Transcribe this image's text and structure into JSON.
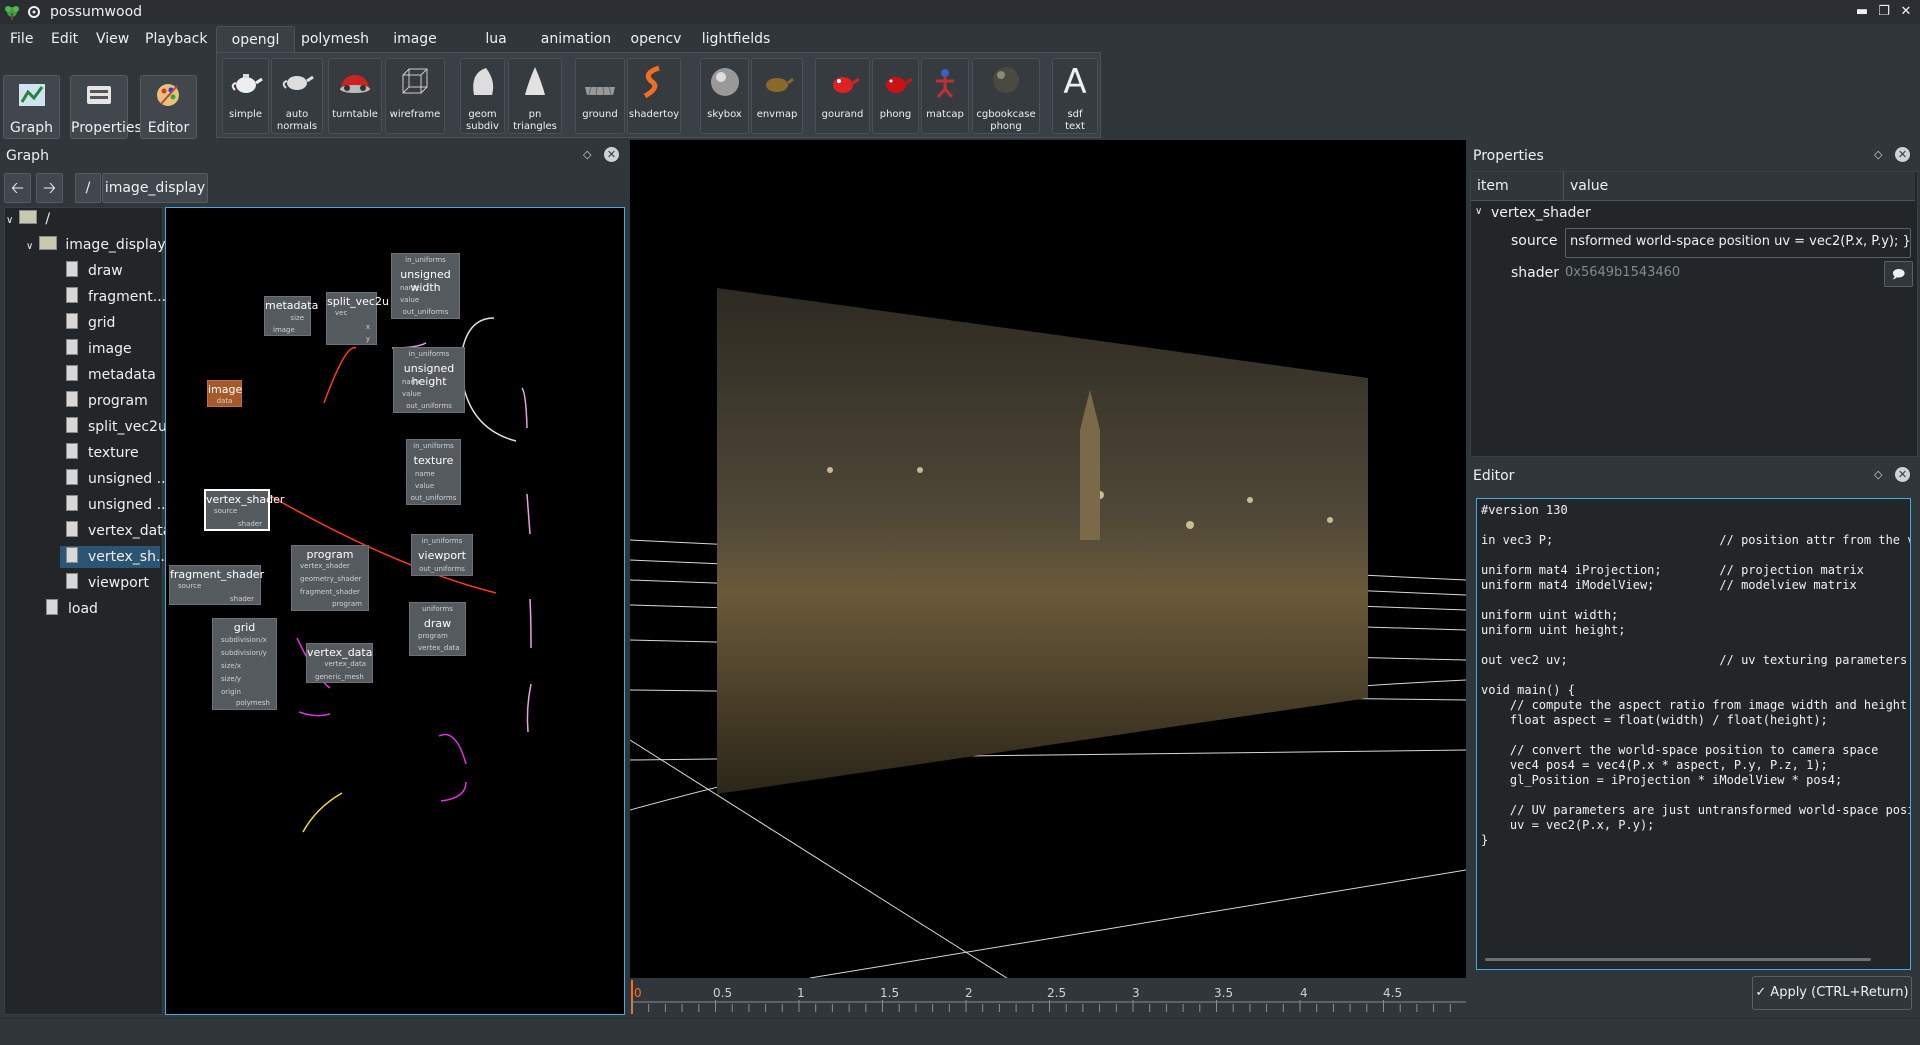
{
  "window": {
    "title": "possumwood",
    "controls": [
      "minimize-icon",
      "maximize-icon",
      "close-icon"
    ]
  },
  "menu": [
    "File",
    "Edit",
    "View",
    "Playback"
  ],
  "tabs": [
    {
      "label": "opengl",
      "active": true
    },
    {
      "label": "polymesh"
    },
    {
      "label": "image"
    },
    {
      "label": "lua"
    },
    {
      "label": "animation"
    },
    {
      "label": "opencv"
    },
    {
      "label": "lightfields"
    }
  ],
  "mode_buttons": [
    {
      "label": "Graph",
      "icon": "graph-icon"
    },
    {
      "label": "Properties",
      "icon": "properties-icon"
    },
    {
      "label": "Editor",
      "icon": "editor-icon"
    }
  ],
  "shelf": [
    {
      "label": "simple",
      "icon": "teapot-icon"
    },
    {
      "label": "auto\nnormals",
      "icon": "teapot-icon"
    },
    {
      "label": "turntable",
      "icon": "car-icon"
    },
    {
      "label": "wireframe",
      "icon": "cube-wireframe-icon"
    },
    {
      "label": "geom\nsubdiv",
      "icon": "subdiv-icon"
    },
    {
      "label": "pn\ntriangles",
      "icon": "cone-icon"
    },
    {
      "label": "ground",
      "icon": "ground-icon"
    },
    {
      "label": "shadertoy",
      "icon": "shadertoy-icon"
    },
    {
      "label": "skybox",
      "icon": "sphere-icon"
    },
    {
      "label": "envmap",
      "icon": "envmap-icon"
    },
    {
      "label": "gourand",
      "icon": "red-teapot-icon"
    },
    {
      "label": "phong",
      "icon": "red-teapot-icon"
    },
    {
      "label": "matcap",
      "icon": "matcap-icon"
    },
    {
      "label": "cgbookcase\nphong",
      "icon": "textured-sphere-icon"
    },
    {
      "label": "sdf\ntext",
      "icon": "sdf-text-icon"
    }
  ],
  "sdf_glyph": "A",
  "graph_panel": {
    "title": "Graph",
    "path_root": "/",
    "path_current": "image_display",
    "tree": [
      {
        "label": "/",
        "level": 0,
        "type": "folder",
        "expanded": true
      },
      {
        "label": "image_display",
        "level": 1,
        "type": "folder",
        "expanded": true
      },
      {
        "label": "draw",
        "level": 2,
        "type": "node"
      },
      {
        "label": "fragment...",
        "level": 2,
        "type": "node"
      },
      {
        "label": "grid",
        "level": 2,
        "type": "node"
      },
      {
        "label": "image",
        "level": 2,
        "type": "node"
      },
      {
        "label": "metadata",
        "level": 2,
        "type": "node"
      },
      {
        "label": "program",
        "level": 2,
        "type": "node"
      },
      {
        "label": "split_vec2u",
        "level": 2,
        "type": "node"
      },
      {
        "label": "texture",
        "level": 2,
        "type": "node"
      },
      {
        "label": "unsigned ...",
        "level": 2,
        "type": "node"
      },
      {
        "label": "unsigned ...",
        "level": 2,
        "type": "node"
      },
      {
        "label": "vertex_data",
        "level": 2,
        "type": "node"
      },
      {
        "label": "vertex_sh...",
        "level": 2,
        "type": "node",
        "selected": true
      },
      {
        "label": "viewport",
        "level": 2,
        "type": "node"
      },
      {
        "label": "load",
        "level": 1,
        "type": "node"
      }
    ]
  },
  "nodes": {
    "metadata": {
      "title": "metadata",
      "ports": [
        "size",
        "image"
      ]
    },
    "split": {
      "title": "split_vec2u",
      "ports": [
        "vec",
        "x",
        "y"
      ]
    },
    "uw": {
      "title": "unsigned width",
      "ports": [
        "in_uniforms",
        "name",
        "value",
        "out_uniforms"
      ]
    },
    "uh": {
      "title": "unsigned height",
      "ports": [
        "in_uniforms",
        "name",
        "value",
        "out_uniforms"
      ]
    },
    "image": {
      "title": "image",
      "ports": [
        "data"
      ]
    },
    "texture": {
      "title": "texture",
      "ports": [
        "in_uniforms",
        "name",
        "value",
        "out_uniforms"
      ]
    },
    "vs": {
      "title": "vertex_shader",
      "ports": [
        "source",
        "shader"
      ]
    },
    "fs": {
      "title": "fragment_shader",
      "ports": [
        "source",
        "shader"
      ]
    },
    "program": {
      "title": "program",
      "ports": [
        "vertex_shader",
        "geometry_shader",
        "fragment_shader",
        "program"
      ]
    },
    "viewport": {
      "title": "viewport",
      "ports": [
        "in_uniforms",
        "out_uniforms"
      ]
    },
    "draw": {
      "title": "draw",
      "ports": [
        "uniforms",
        "program",
        "vertex_data"
      ]
    },
    "vdata": {
      "title": "vertex_data",
      "ports": [
        "vertex_data",
        "generic_mesh"
      ]
    },
    "grid": {
      "title": "grid",
      "ports": [
        "subdivision/x",
        "subdivision/y",
        "size/x",
        "size/y",
        "origin",
        "polymesh"
      ]
    }
  },
  "properties_panel": {
    "title": "Properties",
    "col_item": "item",
    "col_value": "value",
    "group": "vertex_shader",
    "rows": [
      {
        "item": "source",
        "value": "nsformed world-space position       uv = vec2(P.x, P.y); }"
      },
      {
        "item": "shader",
        "value": "0x5649b1543460"
      }
    ]
  },
  "editor_panel": {
    "title": "Editor",
    "code": "#version 130\n\nin vec3 P;                       // position attr from the vbo\n\nuniform mat4 iProjection;        // projection matrix\nuniform mat4 iModelView;         // modelview matrix\n\nuniform uint width;\nuniform uint height;\n\nout vec2 uv;                     // uv texturing parameters\n\nvoid main() {\n    // compute the aspect ratio from image width and height\n    float aspect = float(width) / float(height);\n\n    // convert the world-space position to camera space\n    vec4 pos4 = vec4(P.x * aspect, P.y, P.z, 1);\n    gl_Position = iProjection * iModelView * pos4;\n\n    // UV parameters are just untransformed world-space position\n    uv = vec2(P.x, P.y);\n}",
    "apply_label": "Apply (CTRL+Return)"
  },
  "timeline": {
    "ticks": [
      "0",
      "0.5",
      "1",
      "1.5",
      "2",
      "2.5",
      "3",
      "3.5",
      "4",
      "4.5"
    ]
  },
  "colors": {
    "accent": "#3daee9",
    "background": "#31363b",
    "viewport": "#000000",
    "image_node": "#a8592b",
    "link_red": "#ff3a1a",
    "link_magenta": "#e030e0",
    "link_yellow": "#f0e020"
  }
}
